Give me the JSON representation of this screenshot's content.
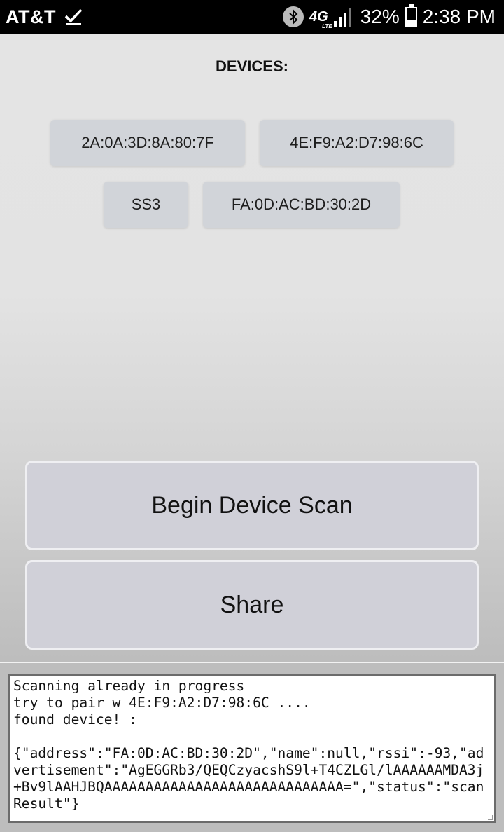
{
  "status_bar": {
    "carrier": "AT&T",
    "network_type": "4G",
    "network_sub": "LTE",
    "battery_percent": "32%",
    "time": "2:38 PM",
    "battery_level": 0.32,
    "icons": [
      "check-icon",
      "bluetooth-icon",
      "signal-icon",
      "battery-icon"
    ]
  },
  "devices": {
    "heading": "DEVICES:",
    "items": [
      "2A:0A:3D:8A:80:7F",
      "4E:F9:A2:D7:98:6C",
      "SS3",
      "FA:0D:AC:BD:30:2D"
    ]
  },
  "actions": {
    "scan_label": "Begin Device Scan",
    "share_label": "Share"
  },
  "log": {
    "text": "Scanning already in progress\ntry to pair w 4E:F9:A2:D7:98:6C ....\nfound device! :\n\n{\"address\":\"FA:0D:AC:BD:30:2D\",\"name\":null,\"rssi\":-93,\"advertisement\":\"AgEGGRb3/QEQCzyacshS9l+T4CZLGl/lAAAAAAMDA3j+Bv9lAAHJBQAAAAAAAAAAAAAAAAAAAAAAAAAAAAA=\",\"status\":\"scanResult\"}"
  },
  "colors": {
    "status_bar_bg": "#000000",
    "chip_bg": "#d1d4d9",
    "button_bg": "#d0d0d8"
  }
}
